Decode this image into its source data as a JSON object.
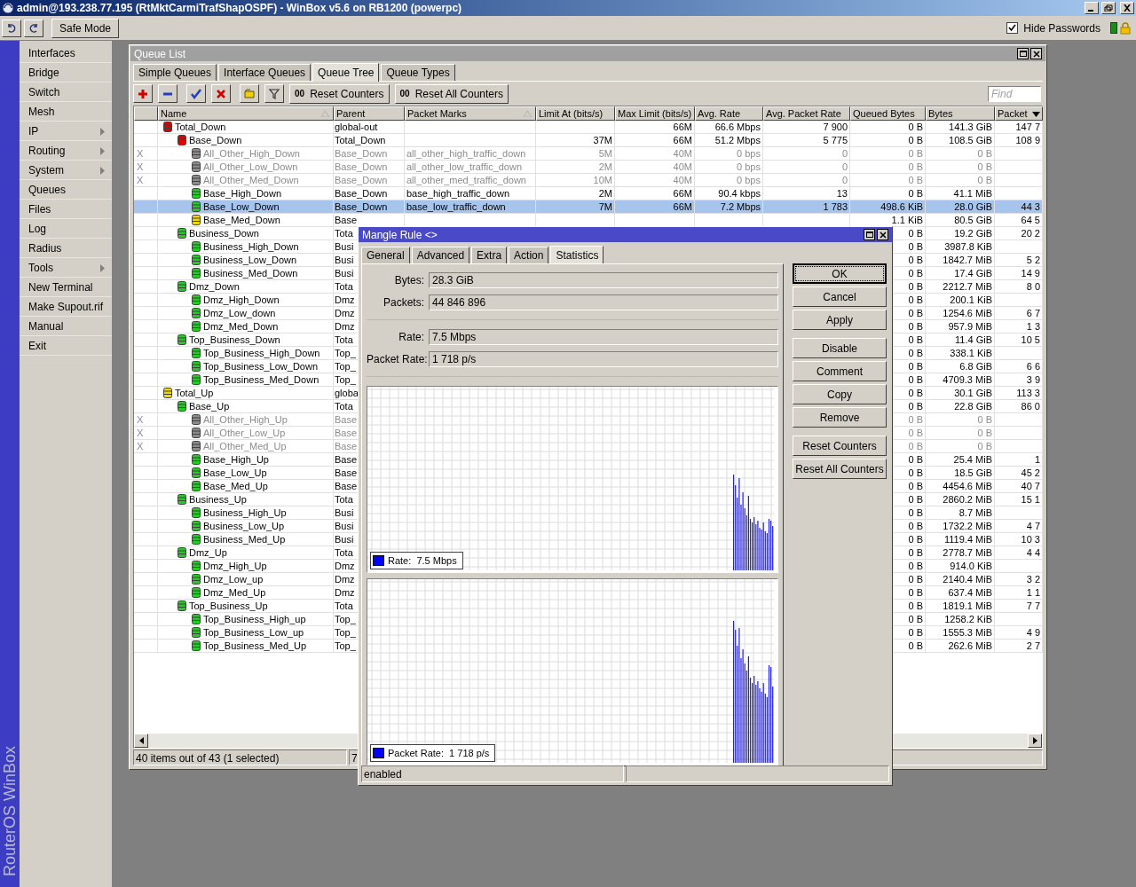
{
  "window": {
    "title": "admin@193.238.77.195 (RtMktCarmiTrafShapOSPF) - WinBox v5.6 on RB1200 (powerpc)"
  },
  "toolbar": {
    "safe_mode": "Safe Mode",
    "hide_passwords": {
      "label": "Hide Passwords",
      "checked": true
    }
  },
  "brand": "RouterOS WinBox",
  "menu": [
    {
      "label": "Interfaces",
      "submenu": false
    },
    {
      "label": "Bridge",
      "submenu": false
    },
    {
      "label": "Switch",
      "submenu": false
    },
    {
      "label": "Mesh",
      "submenu": false
    },
    {
      "label": "IP",
      "submenu": true
    },
    {
      "label": "Routing",
      "submenu": true
    },
    {
      "label": "System",
      "submenu": true
    },
    {
      "label": "Queues",
      "submenu": false
    },
    {
      "label": "Files",
      "submenu": false
    },
    {
      "label": "Log",
      "submenu": false
    },
    {
      "label": "Radius",
      "submenu": false
    },
    {
      "label": "Tools",
      "submenu": true
    },
    {
      "label": "New Terminal",
      "submenu": false
    },
    {
      "label": "Make Supout.rif",
      "submenu": false
    },
    {
      "label": "Manual",
      "submenu": false
    },
    {
      "label": "Exit",
      "submenu": false
    }
  ],
  "queue_list": {
    "title": "Queue List",
    "tabs": [
      {
        "label": "Simple Queues",
        "selected": false
      },
      {
        "label": "Interface Queues",
        "selected": false
      },
      {
        "label": "Queue Tree",
        "selected": true
      },
      {
        "label": "Queue Types",
        "selected": false
      }
    ],
    "actions": [
      {
        "glyph": "00",
        "label": "Reset Counters"
      },
      {
        "glyph": "00",
        "label": "Reset All Counters"
      }
    ],
    "search": {
      "placeholder": "Find"
    },
    "columns": [
      "Name",
      "Parent",
      "Packet Marks",
      "Limit At (bits/s)",
      "Max Limit (bits/s)",
      "Avg. Rate",
      "Avg. Packet Rate",
      "Queued Bytes",
      "Bytes",
      "Packet"
    ],
    "rows": [
      {
        "name": "Total_Down",
        "color": "#e00000",
        "disabled": false,
        "selected": false,
        "parent": "global-out",
        "max_limit": "66M",
        "avg_rate": "66.6 Mbps",
        "avg_packet_rate": "7 900",
        "queued_bytes": "0 B",
        "bytes": "141.3 GiB",
        "packets": "147 7",
        "children": [
          {
            "name": "Base_Down",
            "color": "#e00000",
            "disabled": false,
            "selected": false,
            "parent": "Total_Down",
            "limit_at": "37M",
            "max_limit": "66M",
            "avg_rate": "51.2 Mbps",
            "avg_packet_rate": "5 775",
            "queued_bytes": "0 B",
            "bytes": "108.5 GiB",
            "packets": "108 9",
            "children": [
              {
                "name": "All_Other_High_Down",
                "color": "#8c8c8c",
                "disabled": true,
                "flag": "X",
                "selected": false,
                "parent": "Base_Down",
                "packet_marks": "all_other_high_traffic_down",
                "limit_at": "5M",
                "max_limit": "40M",
                "avg_rate": "0 bps",
                "avg_packet_rate": "0",
                "queued_bytes": "0 B",
                "bytes": "0 B"
              },
              {
                "name": "All_Other_Low_Down",
                "color": "#8c8c8c",
                "disabled": true,
                "flag": "X",
                "selected": false,
                "parent": "Base_Down",
                "packet_marks": "all_other_low_traffic_down",
                "limit_at": "2M",
                "max_limit": "40M",
                "avg_rate": "0 bps",
                "avg_packet_rate": "0",
                "queued_bytes": "0 B",
                "bytes": "0 B"
              },
              {
                "name": "All_Other_Med_Down",
                "color": "#8c8c8c",
                "disabled": true,
                "flag": "X",
                "selected": false,
                "parent": "Base_Down",
                "packet_marks": "all_other_med_traffic_down",
                "limit_at": "10M",
                "max_limit": "40M",
                "avg_rate": "0 bps",
                "avg_packet_rate": "0",
                "queued_bytes": "0 B",
                "bytes": "0 B"
              },
              {
                "name": "Base_High_Down",
                "color": "#22cc22",
                "disabled": false,
                "selected": false,
                "parent": "Base_Down",
                "packet_marks": "base_high_traffic_down",
                "limit_at": "2M",
                "max_limit": "66M",
                "avg_rate": "90.4 kbps",
                "avg_packet_rate": "13",
                "queued_bytes": "0 B",
                "bytes": "41.1 MiB"
              },
              {
                "name": "Base_Low_Down",
                "color": "#22cc22",
                "disabled": false,
                "selected": true,
                "parent": "Base_Down",
                "packet_marks": "base_low_traffic_down",
                "limit_at": "7M",
                "max_limit": "66M",
                "avg_rate": "7.2 Mbps",
                "avg_packet_rate": "1 783",
                "queued_bytes": "498.6 KiB",
                "bytes": "28.0 GiB",
                "packets": "44 3"
              },
              {
                "name": "Base_Med_Down",
                "color": "#f0d800",
                "disabled": false,
                "selected": false,
                "parent": "Base",
                "queued_bytes": "1.1 KiB",
                "bytes": "80.5 GiB",
                "packets": "64 5"
              }
            ]
          },
          {
            "name": "Business_Down",
            "color": "#22cc22",
            "disabled": false,
            "selected": false,
            "parent": "Tota",
            "queued_bytes": "0 B",
            "bytes": "19.2 GiB",
            "packets": "20 2",
            "children": [
              {
                "name": "Business_High_Down",
                "color": "#22cc22",
                "disabled": false,
                "selected": false,
                "parent": "Busi",
                "queued_bytes": "0 B",
                "bytes": "3987.8 KiB"
              },
              {
                "name": "Business_Low_Down",
                "color": "#22cc22",
                "disabled": false,
                "selected": false,
                "parent": "Busi",
                "queued_bytes": "0 B",
                "bytes": "1842.7 MiB",
                "packets": "5 2"
              },
              {
                "name": "Business_Med_Down",
                "color": "#22cc22",
                "disabled": false,
                "selected": false,
                "parent": "Busi",
                "queued_bytes": "0 B",
                "bytes": "17.4 GiB",
                "packets": "14 9"
              }
            ]
          },
          {
            "name": "Dmz_Down",
            "color": "#22cc22",
            "disabled": false,
            "selected": false,
            "parent": "Tota",
            "queued_bytes": "0 B",
            "bytes": "2212.7 MiB",
            "packets": "8 0",
            "children": [
              {
                "name": "Dmz_High_Down",
                "color": "#22cc22",
                "disabled": false,
                "selected": false,
                "parent": "Dmz",
                "queued_bytes": "0 B",
                "bytes": "200.1 KiB"
              },
              {
                "name": "Dmz_Low_down",
                "color": "#22cc22",
                "disabled": false,
                "selected": false,
                "parent": "Dmz",
                "queued_bytes": "0 B",
                "bytes": "1254.6 MiB",
                "packets": "6 7"
              },
              {
                "name": "Dmz_Med_Down",
                "color": "#22cc22",
                "disabled": false,
                "selected": false,
                "parent": "Dmz",
                "queued_bytes": "0 B",
                "bytes": "957.9 MiB",
                "packets": "1 3"
              }
            ]
          },
          {
            "name": "Top_Business_Down",
            "color": "#22cc22",
            "disabled": false,
            "selected": false,
            "parent": "Tota",
            "queued_bytes": "0 B",
            "bytes": "11.4 GiB",
            "packets": "10 5",
            "children": [
              {
                "name": "Top_Business_High_Down",
                "color": "#22cc22",
                "disabled": false,
                "selected": false,
                "parent": "Top_",
                "queued_bytes": "0 B",
                "bytes": "338.1 KiB"
              },
              {
                "name": "Top_Business_Low_Down",
                "color": "#22cc22",
                "disabled": false,
                "selected": false,
                "parent": "Top_",
                "queued_bytes": "0 B",
                "bytes": "6.8 GiB",
                "packets": "6 6"
              },
              {
                "name": "Top_Business_Med_Down",
                "color": "#22cc22",
                "disabled": false,
                "selected": false,
                "parent": "Top_",
                "queued_bytes": "0 B",
                "bytes": "4709.3 MiB",
                "packets": "3 9"
              }
            ]
          }
        ]
      },
      {
        "name": "Total_Up",
        "color": "#f0d800",
        "disabled": false,
        "selected": false,
        "parent": "globa",
        "queued_bytes": "0 B",
        "bytes": "30.1 GiB",
        "packets": "113 3",
        "children": [
          {
            "name": "Base_Up",
            "color": "#22cc22",
            "disabled": false,
            "selected": false,
            "parent": "Tota",
            "queued_bytes": "0 B",
            "bytes": "22.8 GiB",
            "packets": "86 0",
            "children": [
              {
                "name": "All_Other_High_Up",
                "color": "#8c8c8c",
                "disabled": true,
                "flag": "X",
                "selected": false,
                "parent": "Base",
                "queued_bytes": "0 B",
                "bytes": "0 B"
              },
              {
                "name": "All_Other_Low_Up",
                "color": "#8c8c8c",
                "disabled": true,
                "flag": "X",
                "selected": false,
                "parent": "Base",
                "queued_bytes": "0 B",
                "bytes": "0 B"
              },
              {
                "name": "All_Other_Med_Up",
                "color": "#8c8c8c",
                "disabled": true,
                "flag": "X",
                "selected": false,
                "parent": "Base",
                "queued_bytes": "0 B",
                "bytes": "0 B"
              },
              {
                "name": "Base_High_Up",
                "color": "#22cc22",
                "disabled": false,
                "selected": false,
                "parent": "Base",
                "queued_bytes": "0 B",
                "bytes": "25.4 MiB",
                "packets": "1"
              },
              {
                "name": "Base_Low_Up",
                "color": "#22cc22",
                "disabled": false,
                "selected": false,
                "parent": "Base",
                "queued_bytes": "0 B",
                "bytes": "18.5 GiB",
                "packets": "45 2"
              },
              {
                "name": "Base_Med_Up",
                "color": "#22cc22",
                "disabled": false,
                "selected": false,
                "parent": "Base",
                "queued_bytes": "0 B",
                "bytes": "4454.6 MiB",
                "packets": "40 7"
              }
            ]
          },
          {
            "name": "Business_Up",
            "color": "#22cc22",
            "disabled": false,
            "selected": false,
            "parent": "Tota",
            "queued_bytes": "0 B",
            "bytes": "2860.2 MiB",
            "packets": "15 1",
            "children": [
              {
                "name": "Business_High_Up",
                "color": "#22cc22",
                "disabled": false,
                "selected": false,
                "parent": "Busi",
                "queued_bytes": "0 B",
                "bytes": "8.7 MiB"
              },
              {
                "name": "Business_Low_Up",
                "color": "#22cc22",
                "disabled": false,
                "selected": false,
                "parent": "Busi",
                "queued_bytes": "0 B",
                "bytes": "1732.2 MiB",
                "packets": "4 7"
              },
              {
                "name": "Business_Med_Up",
                "color": "#22cc22",
                "disabled": false,
                "selected": false,
                "parent": "Busi",
                "queued_bytes": "0 B",
                "bytes": "1119.4 MiB",
                "packets": "10 3"
              }
            ]
          },
          {
            "name": "Dmz_Up",
            "color": "#22cc22",
            "disabled": false,
            "selected": false,
            "parent": "Tota",
            "queued_bytes": "0 B",
            "bytes": "2778.7 MiB",
            "packets": "4 4",
            "children": [
              {
                "name": "Dmz_High_Up",
                "color": "#22cc22",
                "disabled": false,
                "selected": false,
                "parent": "Dmz",
                "queued_bytes": "0 B",
                "bytes": "914.0 KiB"
              },
              {
                "name": "Dmz_Low_up",
                "color": "#22cc22",
                "disabled": false,
                "selected": false,
                "parent": "Dmz",
                "queued_bytes": "0 B",
                "bytes": "2140.4 MiB",
                "packets": "3 2"
              },
              {
                "name": "Dmz_Med_Up",
                "color": "#22cc22",
                "disabled": false,
                "selected": false,
                "parent": "Dmz",
                "queued_bytes": "0 B",
                "bytes": "637.4 MiB",
                "packets": "1 1"
              }
            ]
          },
          {
            "name": "Top_Business_Up",
            "color": "#22cc22",
            "disabled": false,
            "selected": false,
            "parent": "Tota",
            "queued_bytes": "0 B",
            "bytes": "1819.1 MiB",
            "packets": "7 7",
            "children": [
              {
                "name": "Top_Business_High_up",
                "color": "#22cc22",
                "disabled": false,
                "selected": false,
                "parent": "Top_",
                "queued_bytes": "0 B",
                "bytes": "1258.2 KiB"
              },
              {
                "name": "Top_Business_Low_up",
                "color": "#22cc22",
                "disabled": false,
                "selected": false,
                "parent": "Top_",
                "queued_bytes": "0 B",
                "bytes": "1555.3 MiB",
                "packets": "4 9"
              },
              {
                "name": "Top_Business_Med_Up",
                "color": "#22cc22",
                "disabled": false,
                "selected": false,
                "parent": "Top_",
                "queued_bytes": "0 B",
                "bytes": "262.6 MiB",
                "packets": "2 7"
              }
            ]
          }
        ]
      }
    ],
    "status_bar": [
      "40 items out of 43 (1 selected)",
      "7"
    ]
  },
  "mangle_rule": {
    "title": "Mangle Rule <>",
    "tabs": [
      {
        "label": "General",
        "selected": false
      },
      {
        "label": "Advanced",
        "selected": false
      },
      {
        "label": "Extra",
        "selected": false
      },
      {
        "label": "Action",
        "selected": false
      },
      {
        "label": "Statistics",
        "selected": true
      }
    ],
    "counters": [
      {
        "label": "Bytes:",
        "value": "28.3 GiB"
      },
      {
        "label": "Packets:",
        "value": "44 846 896"
      }
    ],
    "rates": [
      {
        "label": "Rate:",
        "value": "7.5 Mbps"
      },
      {
        "label": "Packet Rate:",
        "value": "1 718 p/s"
      }
    ],
    "graphs": [
      {
        "legend": "Rate:  7.5 Mbps"
      },
      {
        "legend": "Packet Rate:  1 718 p/s"
      }
    ],
    "buttons": [
      {
        "label": "OK",
        "default": true
      },
      {
        "label": "Cancel",
        "default": false
      },
      {
        "label": "Apply",
        "default": false
      },
      {
        "label": "Disable",
        "default": false
      },
      {
        "label": "Comment",
        "default": false
      },
      {
        "label": "Copy",
        "default": false
      },
      {
        "label": "Remove",
        "default": false
      },
      {
        "label": "Reset Counters",
        "default": false
      },
      {
        "label": "Reset All Counters",
        "default": false
      }
    ],
    "status_bar": [
      "enabled"
    ]
  }
}
